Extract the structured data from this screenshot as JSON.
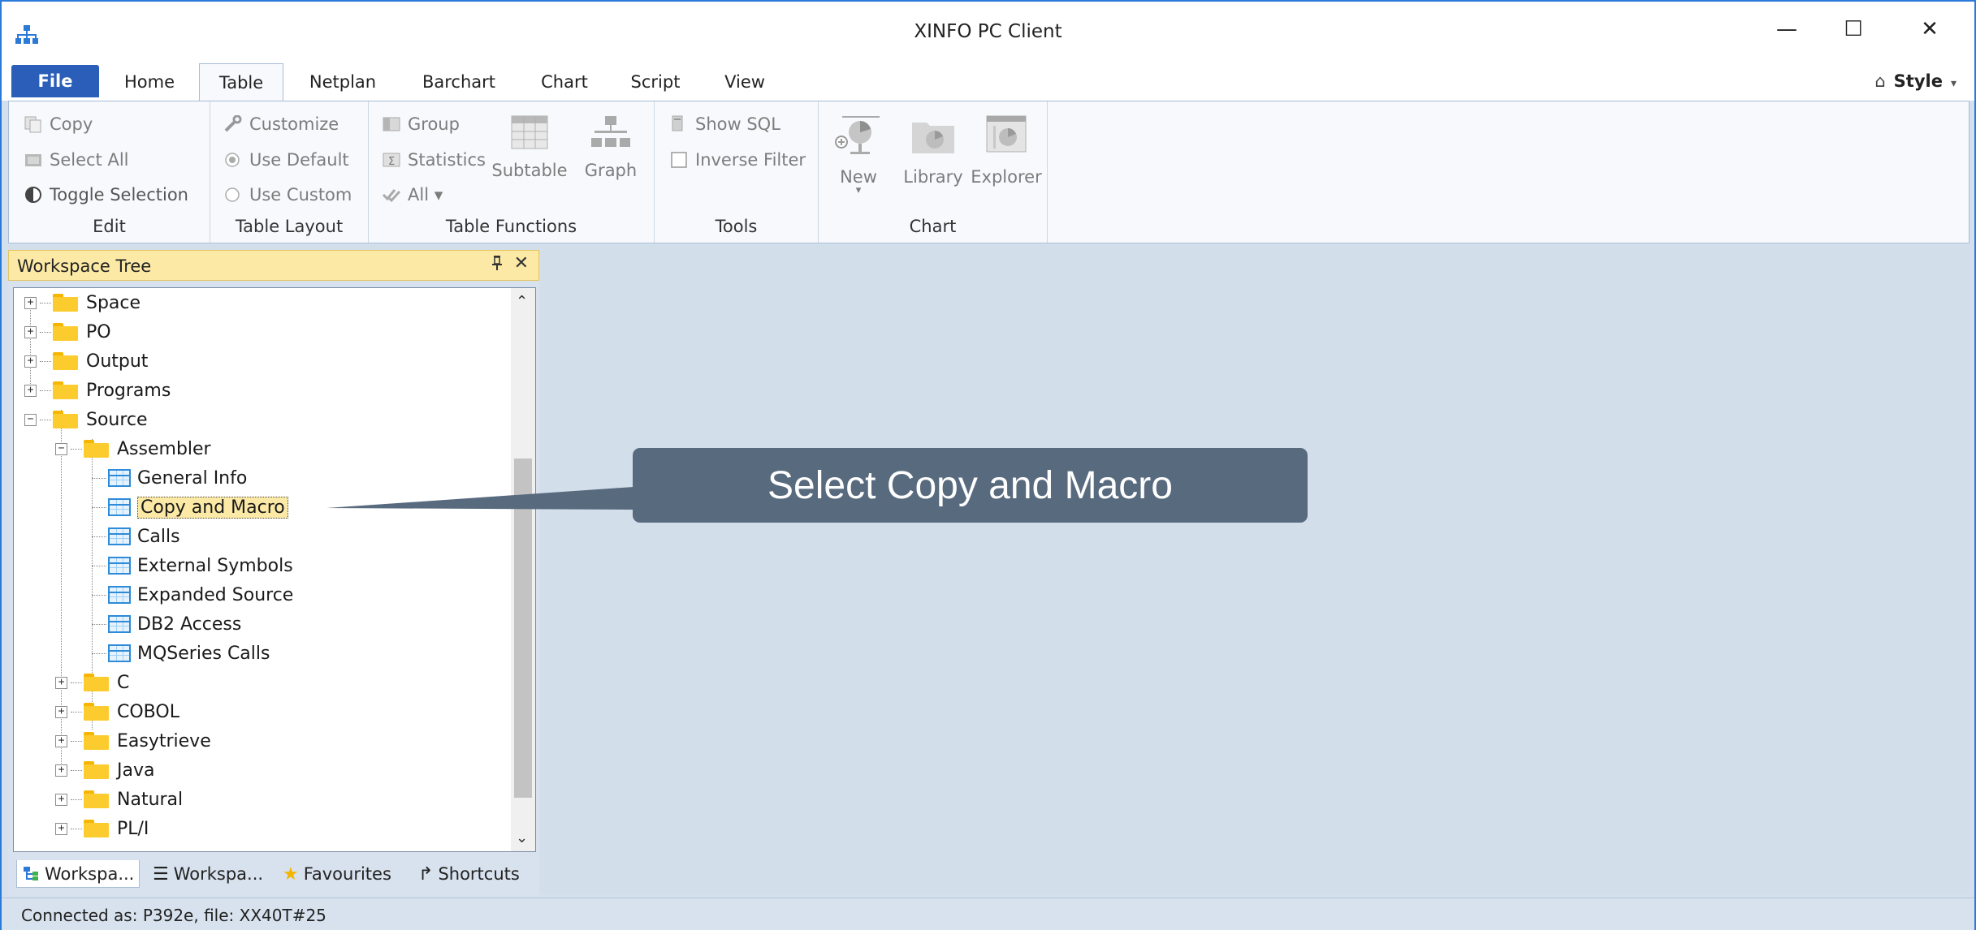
{
  "window": {
    "title": "XINFO PC Client",
    "minimize": "—",
    "maximize": "☐",
    "close": "✕"
  },
  "tabs": {
    "file": "File",
    "home": "Home",
    "table": "Table",
    "netplan": "Netplan",
    "barchart": "Barchart",
    "chart": "Chart",
    "script": "Script",
    "view": "View",
    "style": "Style"
  },
  "ribbon": {
    "edit": {
      "label": "Edit",
      "copy": "Copy",
      "select_all": "Select All",
      "toggle_selection": "Toggle Selection"
    },
    "table_layout": {
      "label": "Table Layout",
      "customize": "Customize",
      "use_default": "Use Default",
      "use_custom": "Use Custom"
    },
    "table_functions": {
      "label": "Table Functions",
      "group": "Group",
      "statistics": "Statistics",
      "all": "All ▾",
      "subtable": "Subtable",
      "graph": "Graph"
    },
    "tools": {
      "label": "Tools",
      "show_sql": "Show SQL",
      "inverse_filter": "Inverse Filter"
    },
    "chart": {
      "label": "Chart",
      "new": "New",
      "new_caret": "▾",
      "library": "Library",
      "explorer": "Explorer"
    }
  },
  "workspace": {
    "title": "Workspace Tree",
    "pin": "ᵖ",
    "close": "✕",
    "tree": {
      "space": "Space",
      "po": "PO",
      "output": "Output",
      "programs": "Programs",
      "source": "Source",
      "assembler": "Assembler",
      "general_info": "General Info",
      "copy_and_macro": "Copy and Macro",
      "calls": "Calls",
      "external_symbols": "External Symbols",
      "expanded_source": "Expanded Source",
      "db2_access": "DB2 Access",
      "mqseries_calls": "MQSeries Calls",
      "c": "C",
      "cobol": "COBOL",
      "easytrieve": "Easytrieve",
      "java": "Java",
      "natural": "Natural",
      "pli": "PL/I"
    },
    "bottom_tabs": {
      "workspace_tree": "Workspa...",
      "workspace_list": "Workspa...",
      "favourites": "Favourites",
      "shortcuts": "Shortcuts"
    }
  },
  "callout": {
    "text": "Select Copy and Macro"
  },
  "status": {
    "text": "Connected as: P392e, file: XX40T#25"
  }
}
